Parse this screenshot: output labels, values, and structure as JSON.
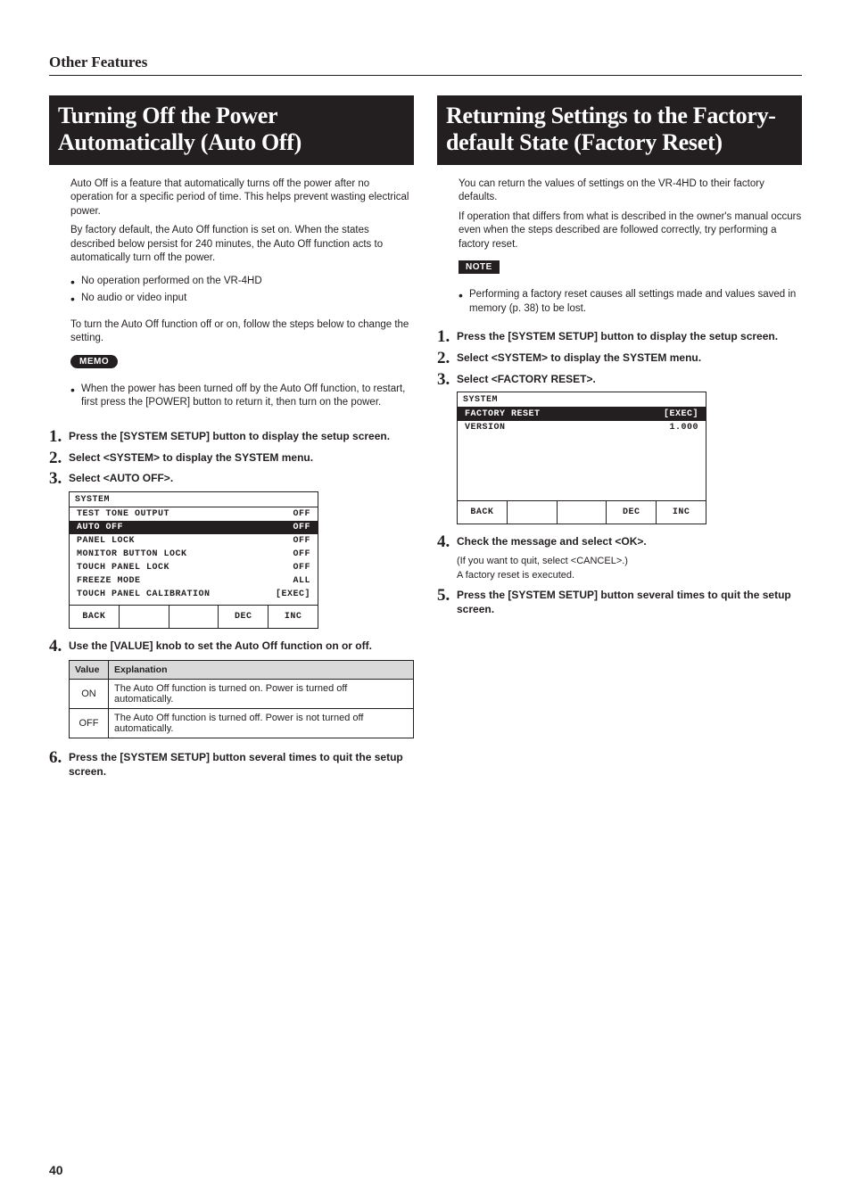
{
  "runningHead": "Other Features",
  "pageNumber": "40",
  "left": {
    "heading": "Turning Off the Power Automatically (Auto Off)",
    "intro1": "Auto Off is a feature that automatically turns off the power after no operation for a specific period of time. This helps prevent wasting electrical power.",
    "intro2": "By factory default, the Auto Off function is set on. When the states described below persist for 240 minutes, the Auto Off function acts to automatically turn off the power.",
    "bullets": [
      "No operation performed on the VR-4HD",
      "No audio or video input"
    ],
    "intro3": "To turn the Auto Off function off or on, follow the steps below to change the setting.",
    "memoLabel": "MEMO",
    "memoItems": [
      "When the power has been turned off by the Auto Off function, to restart, first press the [POWER] button to return it, then turn on the power."
    ],
    "steps": [
      {
        "num": "1.",
        "text": "Press the [SYSTEM SETUP] button to display the setup screen."
      },
      {
        "num": "2.",
        "text": "Select <SYSTEM> to display the SYSTEM menu."
      },
      {
        "num": "3.",
        "text": "Select <AUTO OFF>."
      }
    ],
    "menu": {
      "title": "SYSTEM",
      "rows": [
        {
          "label": "TEST TONE OUTPUT",
          "value": "OFF",
          "sel": false
        },
        {
          "label": "AUTO OFF",
          "value": "OFF",
          "sel": true
        },
        {
          "label": "PANEL LOCK",
          "value": "OFF",
          "sel": false
        },
        {
          "label": "MONITOR BUTTON LOCK",
          "value": "OFF",
          "sel": false
        },
        {
          "label": "TOUCH PANEL LOCK",
          "value": "OFF",
          "sel": false
        },
        {
          "label": "FREEZE MODE",
          "value": "ALL",
          "sel": false
        },
        {
          "label": "TOUCH PANEL CALIBRATION",
          "value": "[EXEC]",
          "sel": false
        }
      ],
      "btns": [
        "BACK",
        "",
        "",
        "DEC",
        "INC"
      ]
    },
    "step4": {
      "num": "4.",
      "text": "Use the [VALUE] knob to set the Auto Off function on or off."
    },
    "table": {
      "headers": [
        "Value",
        "Explanation"
      ],
      "rows": [
        {
          "value": "ON",
          "exp": "The Auto Off function is turned on. Power is turned off automatically."
        },
        {
          "value": "OFF",
          "exp": "The Auto Off function is turned off. Power is not turned off automatically."
        }
      ]
    },
    "step6": {
      "num": "6.",
      "text": "Press the [SYSTEM SETUP] button several times to quit the setup screen."
    }
  },
  "right": {
    "heading": "Returning Settings to the Factory-default State (Factory Reset)",
    "intro1": "You can return the values of settings on the VR-4HD to their factory defaults.",
    "intro2": "If operation that differs from what is described in the owner's manual occurs even when the steps described are followed correctly, try performing a factory reset.",
    "noteLabel": "NOTE",
    "noteItems": [
      "Performing a factory reset causes all settings made and values saved in memory (p. 38) to be lost."
    ],
    "steps": [
      {
        "num": "1.",
        "text": "Press the [SYSTEM SETUP] button to display the setup screen."
      },
      {
        "num": "2.",
        "text": "Select <SYSTEM> to display the SYSTEM menu."
      },
      {
        "num": "3.",
        "text": "Select <FACTORY RESET>."
      }
    ],
    "menu": {
      "title": "SYSTEM",
      "rows": [
        {
          "label": "FACTORY RESET",
          "value": "[EXEC]",
          "sel": true
        },
        {
          "label": "VERSION",
          "value": "1.000",
          "sel": false
        }
      ],
      "btns": [
        "BACK",
        "",
        "",
        "DEC",
        "INC"
      ]
    },
    "step4": {
      "num": "4.",
      "text": "Check the message and select <OK>."
    },
    "step4sub1": "(If you want to quit, select <CANCEL>.)",
    "step4sub2": "A factory reset is executed.",
    "step5": {
      "num": "5.",
      "text": "Press the [SYSTEM SETUP] button several times to quit the setup screen."
    }
  }
}
